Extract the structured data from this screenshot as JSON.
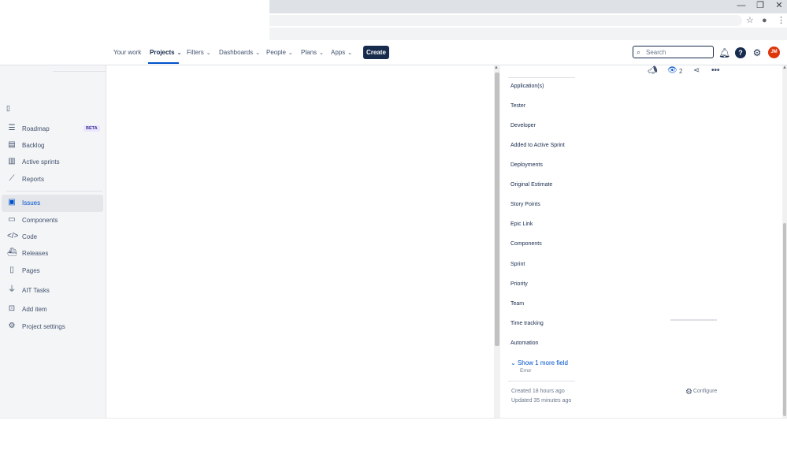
{
  "nav": {
    "items": [
      "Your work",
      "Projects",
      "Filters",
      "Dashboards",
      "People",
      "Plans",
      "Apps"
    ],
    "create_label": "Create",
    "search_placeholder": "Search",
    "avatar_initials": "JM"
  },
  "sidebar": {
    "items": [
      {
        "label": "Roadmap",
        "badge": "BETA",
        "icon": "roadmap-icon"
      },
      {
        "label": "Backlog",
        "icon": "backlog-icon"
      },
      {
        "label": "Active sprints",
        "icon": "board-icon"
      },
      {
        "label": "Reports",
        "icon": "reports-icon"
      },
      {
        "label": "Issues",
        "icon": "issues-icon",
        "active": true
      },
      {
        "label": "Components",
        "icon": "components-icon"
      },
      {
        "label": "Code",
        "icon": "code-icon"
      },
      {
        "label": "Releases",
        "icon": "releases-icon"
      },
      {
        "label": "Pages",
        "icon": "pages-icon"
      },
      {
        "label": "AIT Tasks",
        "icon": "plug-icon"
      },
      {
        "label": "Add item",
        "icon": "add-item-icon"
      },
      {
        "label": "Project settings",
        "icon": "gear-icon"
      }
    ]
  },
  "detail": {
    "watch_count": "2",
    "fields": [
      "Application(s)",
      "Tester",
      "Developer",
      "Added to Active Sprint",
      "Deployments",
      "Original Estimate",
      "Story Points",
      "Epic Link",
      "Components",
      "Sprint",
      "Priority",
      "Team",
      "Time tracking",
      "Automation"
    ],
    "show_more": "Show 1 more field",
    "error": "Error",
    "created": "Created 18 hours ago",
    "updated": "Updated 35 minutes ago",
    "configure": "Configure"
  },
  "colors": {
    "accent": "#0052cc",
    "nav_dark": "#172b4d",
    "avatar": "#de350b"
  }
}
